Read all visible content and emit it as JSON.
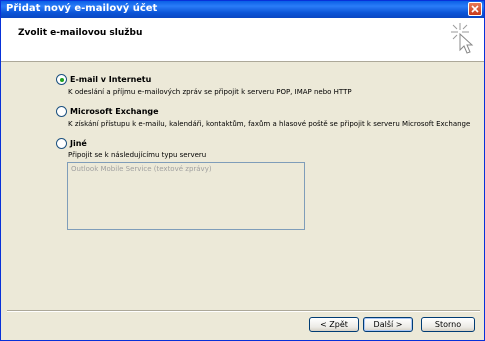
{
  "window": {
    "title": "Přidat nový e-mailový účet"
  },
  "header": {
    "title": "Zvolit e-mailovou službu",
    "icon": "wand-cursor-icon"
  },
  "options": [
    {
      "label": "E-mail v Internetu",
      "description": "K odeslání a příjmu e-mailových zpráv se připojit k serveru POP, IMAP nebo HTTP",
      "selected": true
    },
    {
      "label": "Microsoft Exchange",
      "description": "K získání přístupu k e-mailu, kalendáři, kontaktům, faxům a hlasové poště se připojit k serveru Microsoft Exchange",
      "selected": false
    },
    {
      "label": "Jiné",
      "description": "Připojit se k následujícímu typu serveru",
      "selected": false
    }
  ],
  "other_servers": [
    "Outlook Mobile Service (textové zprávy)"
  ],
  "buttons": {
    "back": "< Zpět",
    "next": "Další >",
    "cancel": "Storno"
  }
}
